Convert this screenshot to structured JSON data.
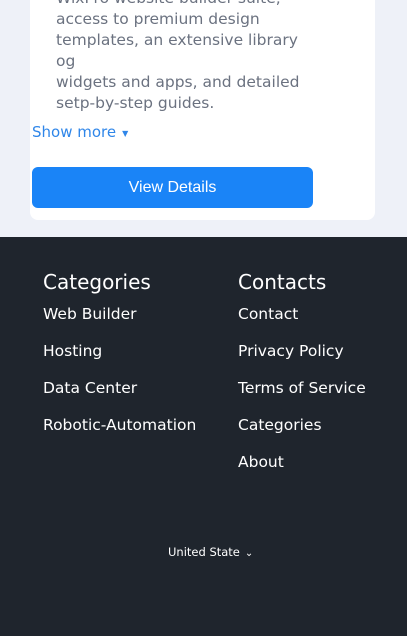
{
  "card": {
    "description_lines": [
      "WixPro website builder suite,",
      "access to premium design",
      "templates, an extensive library og",
      "widgets and apps, and detailed",
      "setp-by-step guides."
    ],
    "show_more_label": "Show more",
    "view_details_label": "View Details"
  },
  "footer": {
    "categories": {
      "title": "Categories",
      "items": [
        "Web Builder",
        "Hosting",
        "Data Center",
        "Robotic-Automation"
      ]
    },
    "contacts": {
      "title": "Contacts",
      "items": [
        "Contact",
        "Privacy Policy",
        "Terms of Service",
        "Categories",
        "About"
      ]
    },
    "region_label": "United State"
  },
  "icons": {
    "show_more": "chevron-down-icon",
    "region": "chevron-down-icon"
  },
  "colors": {
    "accent": "#1a84f7",
    "link": "#2f86e9",
    "footer_bg": "#1f252d",
    "page_bg": "#eef1f8"
  }
}
